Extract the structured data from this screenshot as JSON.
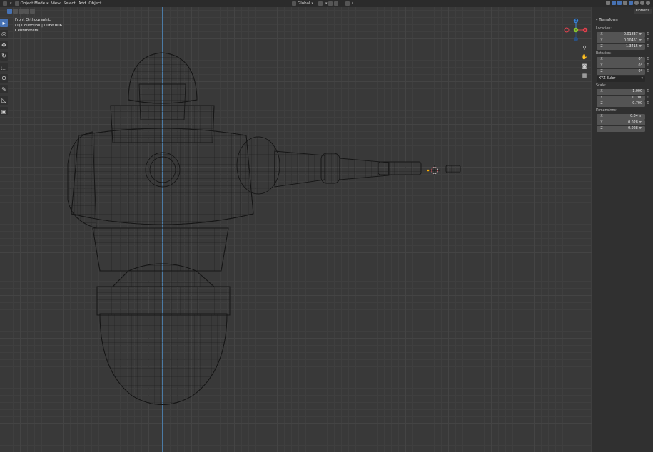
{
  "header": {
    "editor_icon": "3d-viewport-icon",
    "mode": "Object Mode",
    "menus": [
      "View",
      "Select",
      "Add",
      "Object"
    ],
    "transform_orientation": "Global",
    "options_label": "Options"
  },
  "overlay": {
    "view_name": "Front Orthographic",
    "collection_line": "(1) Collection | Cube.006",
    "units": "Centimeters"
  },
  "toolbar": {
    "tools": [
      {
        "name": "select-tool",
        "glyph": "▸",
        "active": true
      },
      {
        "name": "cursor-tool",
        "glyph": "◎"
      },
      {
        "name": "move-tool",
        "glyph": "✥"
      },
      {
        "name": "rotate-tool",
        "glyph": "↻"
      },
      {
        "name": "scale-tool",
        "glyph": "⬚"
      },
      {
        "name": "transform-tool",
        "glyph": "⊕"
      },
      {
        "name": "annotate-tool",
        "glyph": "✎"
      },
      {
        "name": "measure-tool",
        "glyph": "◺"
      },
      {
        "name": "add-cube-tool",
        "glyph": "▣"
      }
    ]
  },
  "gizmo": {
    "x_label": "X",
    "y_label": "Y",
    "z_label": "Z",
    "x_color": "#e2424e",
    "y_color": "#8bc732",
    "z_color": "#3b82d6"
  },
  "sidebar": {
    "panel_title": "Transform",
    "location_label": "Location:",
    "location": {
      "x": "0.01837 m",
      "y": "0.10461 m",
      "z": "1.3415 m"
    },
    "rotation_label": "Rotation:",
    "rotation": {
      "x": "0°",
      "y": "0°",
      "z": "0°"
    },
    "rotation_mode": "XYZ Euler",
    "scale_label": "Scale:",
    "scale": {
      "x": "1.000",
      "y": "0.700",
      "z": "0.700"
    },
    "dimensions_label": "Dimensions:",
    "dimensions": {
      "x": "0.04 m",
      "y": "0.028 m",
      "z": "0.028 m"
    },
    "axis_labels": {
      "x": "X",
      "y": "Y",
      "z": "Z"
    }
  },
  "colors": {
    "viewport_bg": "#393939",
    "wire": "#111111",
    "accent": "#4772b3",
    "axis_line": "#4b7aa4"
  }
}
